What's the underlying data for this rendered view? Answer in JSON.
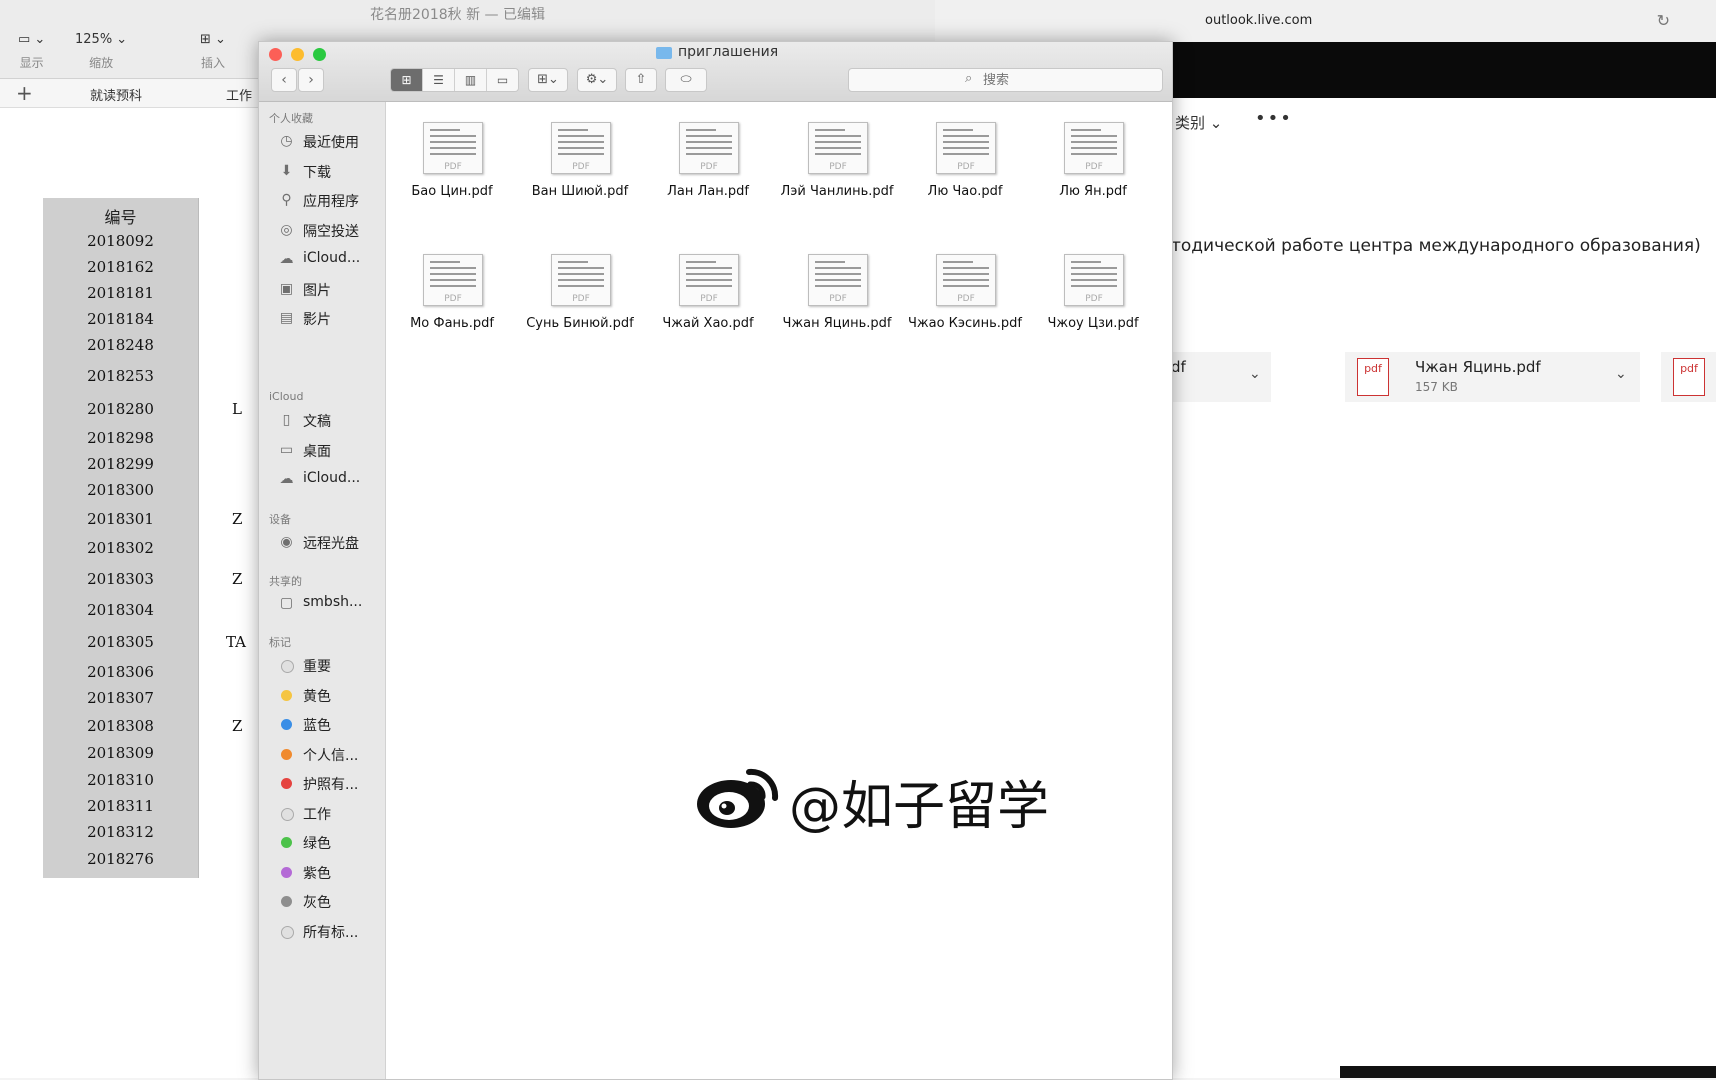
{
  "spreadsheet": {
    "title": "花名册2018秋 新",
    "title_suffix": "已编辑",
    "toolbar": {
      "view_label": "显示",
      "zoom_value": "125%",
      "zoom_label": "缩放",
      "insert_label": "插入"
    },
    "tabs": [
      "就读预科",
      "工作"
    ],
    "column_header": "编号",
    "rows": [
      "2018092",
      "2018162",
      "2018181",
      "2018184",
      "2018248",
      "2018253",
      "2018280",
      "2018298",
      "2018299",
      "2018300",
      "2018301",
      "2018302",
      "2018303",
      "2018304",
      "2018305",
      "2018306",
      "2018307",
      "2018308",
      "2018309",
      "2018310",
      "2018311",
      "2018312",
      "2018276"
    ],
    "side_letters": {
      "2018280": "L",
      "2018301": "Z",
      "2018303": "Z",
      "2018305": "TA",
      "2018308": "Z"
    }
  },
  "browser": {
    "url": "outlook.live.com",
    "category_menu": "类别",
    "more_menu": "•••",
    "subject": "тодической работе центра международного образования)",
    "attachments": [
      {
        "name": "df",
        "size": ""
      },
      {
        "name": "Чжан Яцинь.pdf",
        "size": "157 KB"
      }
    ]
  },
  "finder": {
    "title": "приглашения",
    "search_placeholder": "搜索",
    "sidebar": {
      "favorites_header": "个人收藏",
      "favorites": [
        {
          "label": "最近使用",
          "icon": "clock-icon"
        },
        {
          "label": "下载",
          "icon": "download-icon"
        },
        {
          "label": "应用程序",
          "icon": "apps-icon"
        },
        {
          "label": "隔空投送",
          "icon": "airdrop-icon"
        },
        {
          "label": "iCloud...",
          "icon": "cloud-icon"
        },
        {
          "label": "图片",
          "icon": "camera-icon"
        },
        {
          "label": "影片",
          "icon": "film-icon"
        }
      ],
      "icloud_header": "iCloud",
      "icloud": [
        {
          "label": "文稿",
          "icon": "document-icon"
        },
        {
          "label": "桌面",
          "icon": "desktop-icon"
        },
        {
          "label": "iCloud...",
          "icon": "cloud-icon"
        }
      ],
      "devices_header": "设备",
      "devices": [
        {
          "label": "远程光盘",
          "icon": "disc-icon"
        }
      ],
      "shared_header": "共享的",
      "shared": [
        {
          "label": "smbsh...",
          "icon": "monitor-icon"
        }
      ],
      "tags_header": "标记",
      "tags": [
        {
          "label": "重要",
          "color": "#e0e0e0"
        },
        {
          "label": "黄色",
          "color": "#f5c542"
        },
        {
          "label": "蓝色",
          "color": "#3a8ee6"
        },
        {
          "label": "个人信...",
          "color": "#f08a2e"
        },
        {
          "label": "护照有...",
          "color": "#e5433f"
        },
        {
          "label": "工作",
          "color": "#e0e0e0"
        },
        {
          "label": "绿色",
          "color": "#4cc24a"
        },
        {
          "label": "紫色",
          "color": "#b46ad6"
        },
        {
          "label": "灰色",
          "color": "#8e8e8e"
        },
        {
          "label": "所有标...",
          "color": "#e0e0e0"
        }
      ]
    },
    "files": [
      "Бао Цин.pdf",
      "Ван Шиюй.pdf",
      "Лан Лан.pdf",
      "Лэй Чанлинь.pdf",
      "Лю Чао.pdf",
      "Лю Ян.pdf",
      "Мо Фань.pdf",
      "Сунь Бинюй.pdf",
      "Чжай Хао.pdf",
      "Чжан Яцинь.pdf",
      "Чжао Кэсинь.pdf",
      "Чжоу Цзи.pdf"
    ],
    "pdf_thumb_label": "PDF"
  },
  "watermark": {
    "text": "@如子留学"
  }
}
